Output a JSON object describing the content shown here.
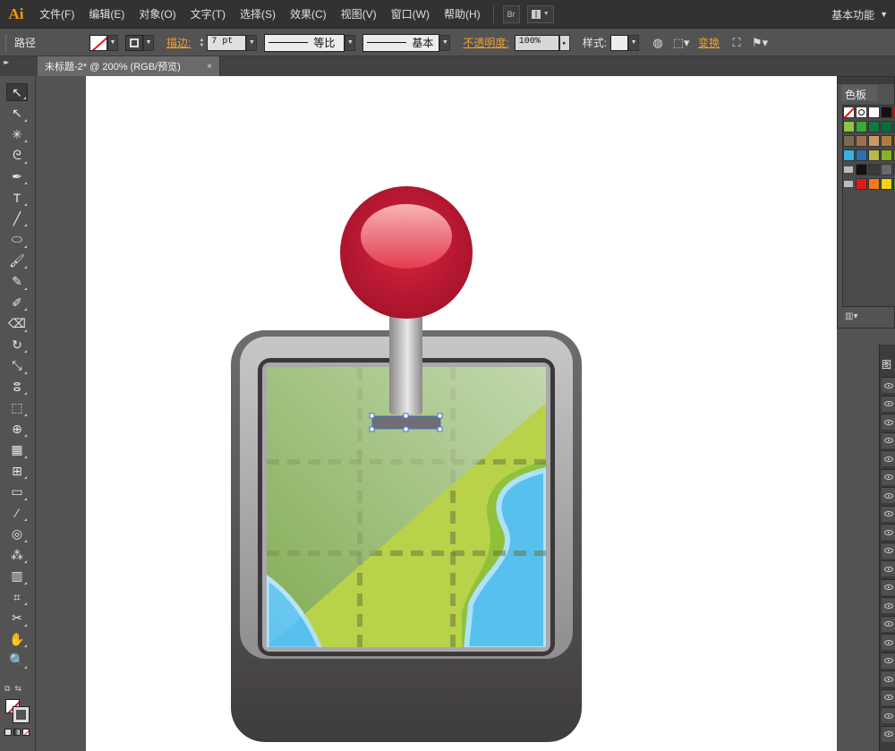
{
  "app": {
    "logo": "Ai"
  },
  "menubar": {
    "items": [
      "文件(F)",
      "编辑(E)",
      "对象(O)",
      "文字(T)",
      "选择(S)",
      "效果(C)",
      "视图(V)",
      "窗口(W)",
      "帮助(H)"
    ],
    "bridge_label": "Br",
    "workspace": "基本功能"
  },
  "controlbar": {
    "selection_type": "路径",
    "stroke_label": "描边:",
    "stroke_weight": "7 pt",
    "stroke_profile": "等比",
    "brush": "基本",
    "opacity_label": "不透明度:",
    "opacity_value": "100%",
    "style_label": "样式:",
    "transform_label": "变换"
  },
  "document": {
    "tab_title": "未标题-2* @ 200% (RGB/预览)",
    "close_glyph": "×"
  },
  "tools": [
    {
      "name": "selection-tool",
      "glyph": "↖"
    },
    {
      "name": "direct-selection-tool",
      "glyph": "↖"
    },
    {
      "name": "magic-wand-tool",
      "glyph": "✳"
    },
    {
      "name": "lasso-tool",
      "glyph": "ᘓ"
    },
    {
      "name": "pen-tool",
      "glyph": "✒"
    },
    {
      "name": "type-tool",
      "glyph": "T"
    },
    {
      "name": "line-tool",
      "glyph": "╱"
    },
    {
      "name": "ellipse-tool",
      "glyph": "⬭"
    },
    {
      "name": "paintbrush-tool",
      "glyph": "🖌"
    },
    {
      "name": "pencil-tool",
      "glyph": "✎"
    },
    {
      "name": "blob-brush-tool",
      "glyph": "✐"
    },
    {
      "name": "eraser-tool",
      "glyph": "⌫"
    },
    {
      "name": "rotate-tool",
      "glyph": "↻"
    },
    {
      "name": "scale-tool",
      "glyph": "⤡"
    },
    {
      "name": "warp-tool",
      "glyph": "ⵓ"
    },
    {
      "name": "free-transform-tool",
      "glyph": "⬚"
    },
    {
      "name": "shape-builder-tool",
      "glyph": "⊕"
    },
    {
      "name": "perspective-grid-tool",
      "glyph": "▦"
    },
    {
      "name": "mesh-tool",
      "glyph": "⊞"
    },
    {
      "name": "gradient-tool",
      "glyph": "▭"
    },
    {
      "name": "eyedropper-tool",
      "glyph": "⁄"
    },
    {
      "name": "blend-tool",
      "glyph": "◎"
    },
    {
      "name": "symbol-sprayer-tool",
      "glyph": "⁂"
    },
    {
      "name": "column-graph-tool",
      "glyph": "▥"
    },
    {
      "name": "artboard-tool",
      "glyph": "⌗"
    },
    {
      "name": "slice-tool",
      "glyph": "✂"
    },
    {
      "name": "hand-tool",
      "glyph": "✋"
    },
    {
      "name": "zoom-tool",
      "glyph": "🔍"
    }
  ],
  "swatches_panel": {
    "title": "色板",
    "footer_icon": "swatch-libraries-menu-icon",
    "colors": [
      [
        "none",
        "registration",
        "#ffffff",
        "#111111",
        "#e8141c"
      ],
      [
        "#8dc63f",
        "#3aa935",
        "#0f7a3c",
        "#0d6b3b",
        "#0e5e40"
      ],
      [
        "#7a6a4f",
        "#a0704a",
        "#c89a6a",
        "#b07c3c",
        "#8a5a2a"
      ],
      [
        "#3ab0e0",
        "#2a6fb0",
        "#b5b84a",
        "#8ab02a",
        "#6a9a2a"
      ],
      [
        "folder",
        "#111111",
        "#3a3a3a",
        "#6a6a6a",
        "#4a4a4a"
      ],
      [
        "folder",
        "#e8141c",
        "#f07a1a",
        "#f5d40a",
        "#3aa935"
      ]
    ]
  },
  "layers_panel": {
    "title_glyph": "图",
    "row_count": 20
  },
  "colors": {
    "accent_orange": "#f0a030",
    "ai_logo": "#ff9a00",
    "menubar_bg": "#323232",
    "panel_bg": "#535353"
  }
}
